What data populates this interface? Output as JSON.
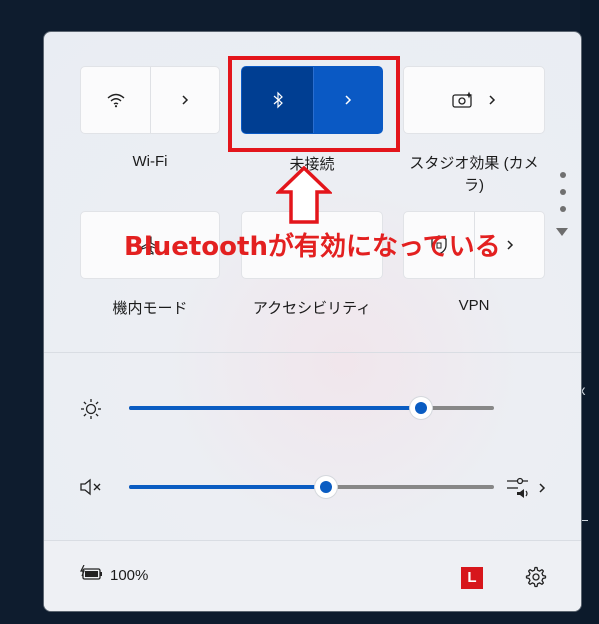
{
  "quick_settings": {
    "tiles": [
      {
        "label": "Wi-Fi",
        "icon": "wifi-icon",
        "state": "off"
      },
      {
        "label": "未接続",
        "icon": "bluetooth-icon",
        "state": "on"
      },
      {
        "label": "スタジオ効果 (カメラ)",
        "label_line1": "スタジオ効果 (カメ",
        "label_line2": "ラ)",
        "icon": "studio-effects-icon",
        "state": "off"
      },
      {
        "label": "機内モード",
        "icon": "airplane-icon",
        "state": "off"
      },
      {
        "label": "アクセシビリティ",
        "icon": "accessibility-icon",
        "state": "off"
      },
      {
        "label": "VPN",
        "icon": "vpn-shield-icon",
        "state": "off"
      }
    ]
  },
  "annotation": {
    "text": "Bluetoothが有効になっている",
    "color": "#e32020"
  },
  "sliders": {
    "brightness": {
      "value": 80,
      "icon": "brightness-icon"
    },
    "volume": {
      "value": 54,
      "icon": "speaker-muted-icon",
      "muted": true,
      "output_icon": "audio-output-icon"
    }
  },
  "footer": {
    "battery": "100%",
    "battery_icon": "battery-charging-icon",
    "tray_badge": "L",
    "settings_icon": "gear-icon"
  },
  "colors": {
    "accent": "#0a5cc2",
    "accent_dark": "#003e92",
    "highlight": "#e3151b"
  }
}
